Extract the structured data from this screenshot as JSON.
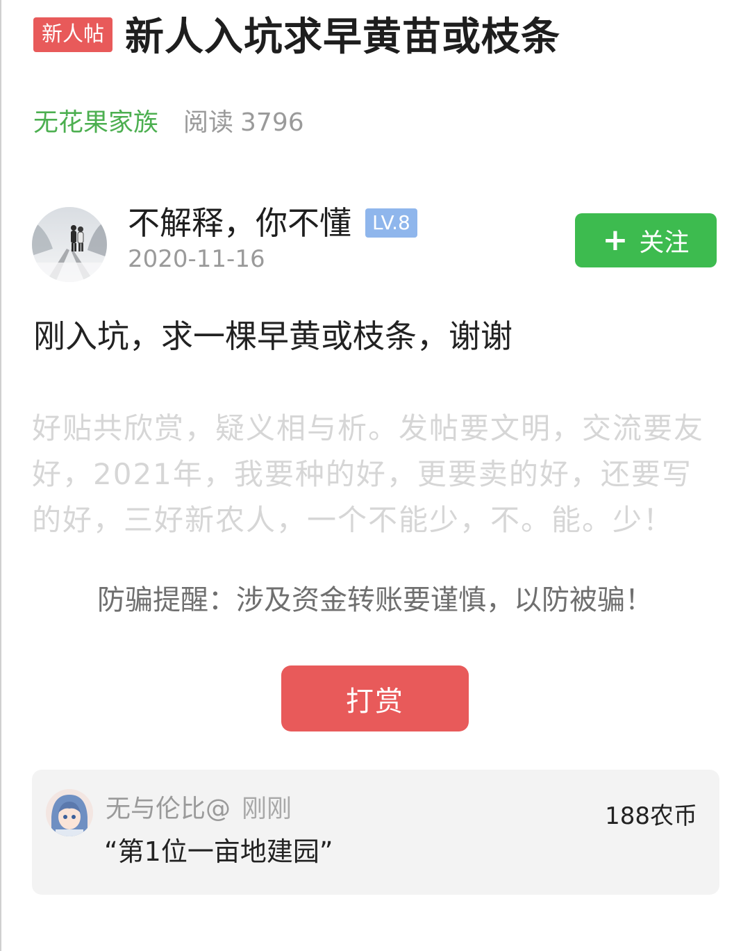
{
  "post": {
    "tag": "新人帖",
    "title": "新人入坑求早黄苗或枝条",
    "group": "无花果家族",
    "read_label": "阅读",
    "read_count": "3796"
  },
  "author": {
    "name": "不解释，你不懂",
    "level": "LV.8",
    "date": "2020-11-16",
    "follow_label": "关注",
    "follow_icon": "plus-icon"
  },
  "content": {
    "body": "刚入坑，求一棵早黄或枝条，谢谢",
    "slogan": "好贴共欣赏，疑义相与析。发帖要文明，交流要友好，2021年，我要种的好，更要卖的好，还要写的好，三好新农人，一个不能少，不。能。少！",
    "fraud_tip": "防骗提醒：涉及资金转账要谨慎，以防被骗！",
    "reward_button": "打赏"
  },
  "rewards": [
    {
      "user": "无与伦比@",
      "time": "刚刚",
      "message": "“第1位一亩地建园”",
      "amount": "188农币"
    }
  ],
  "colors": {
    "accent_green": "#3dbb4f",
    "group_green": "#4caf50",
    "tag_red": "#e85a5a",
    "level_blue": "#8fb6ec"
  }
}
